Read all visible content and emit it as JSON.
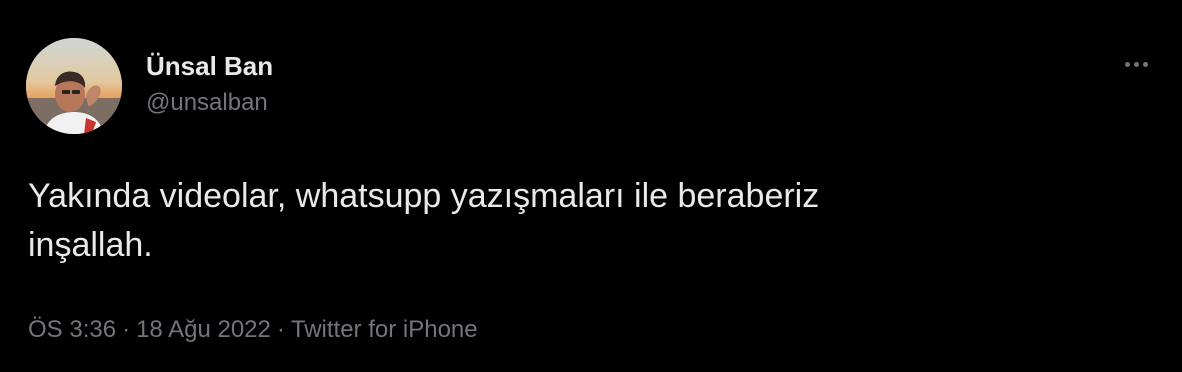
{
  "author": {
    "display_name": "Ünsal Ban",
    "handle": "@unsalban",
    "avatar_icon": "profile-photo"
  },
  "more_icon": "more-horizontal-icon",
  "tweet": {
    "text": "Yakında videolar, whatsupp yazışmaları ile beraberiz\ninşallah."
  },
  "meta": {
    "time": "ÖS 3:36",
    "separator_1": "·",
    "date": "18 Ağu 2022",
    "separator_2": "·",
    "source": "Twitter for iPhone"
  },
  "colors": {
    "background": "#000000",
    "primary_text": "#e7e9ea",
    "secondary_text": "#71767b"
  }
}
